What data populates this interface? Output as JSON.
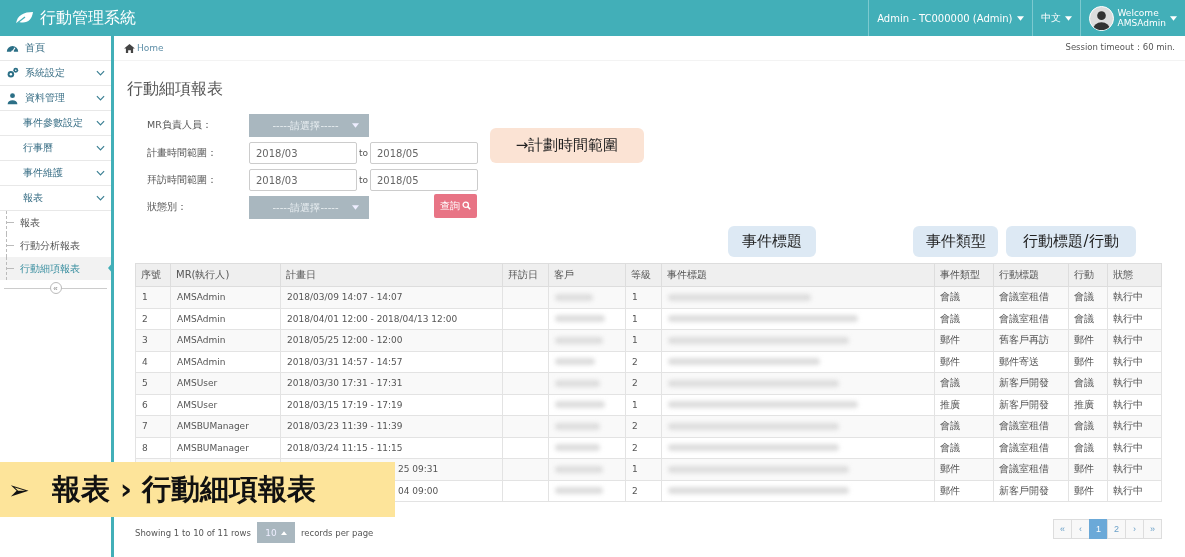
{
  "header": {
    "app_title": "行動管理系統",
    "account": "Admin - TC000000 (Admin)",
    "language": "中文",
    "welcome": "Welcome",
    "user": "AMSAdmin"
  },
  "sidebar": {
    "items": [
      {
        "label": "首頁",
        "kind": "link"
      },
      {
        "label": "系統設定",
        "kind": "menu"
      },
      {
        "label": "資料管理",
        "kind": "menu",
        "children": [
          {
            "label": "事件參數設定",
            "kind": "menu"
          },
          {
            "label": "行事曆",
            "kind": "menu"
          },
          {
            "label": "事件維護",
            "kind": "menu"
          },
          {
            "label": "報表",
            "kind": "menu",
            "children": [
              {
                "label": "報表",
                "selected": false
              },
              {
                "label": "行動分析報表",
                "selected": false
              },
              {
                "label": "行動細項報表",
                "selected": true
              }
            ]
          }
        ]
      }
    ],
    "collapse": "«"
  },
  "breadcrumb": "Home",
  "session": "Session timeout：60 min.",
  "page_title": "行動細項報表",
  "form": [
    {
      "kind": "select",
      "label": "MR負責人員：",
      "placeholder": "-----請選擇-----"
    },
    {
      "kind": "range",
      "label": "計畫時間範圍：",
      "from": "2018/03",
      "sep": "to",
      "to": "2018/05"
    },
    {
      "kind": "range",
      "label": "拜訪時間範圍：",
      "from": "2018/03",
      "sep": "to",
      "to": "2018/05"
    },
    {
      "kind": "select",
      "label": "狀態別：",
      "placeholder": "-----請選擇-----",
      "button": "查詢"
    }
  ],
  "annotations": [
    {
      "kind": "orange",
      "text": "→計劃時間範圍"
    },
    {
      "kind": "blue",
      "text": "事件標題"
    },
    {
      "kind": "blue",
      "text": "事件類型"
    },
    {
      "kind": "blue",
      "text": "行動標題/行動"
    }
  ],
  "table": {
    "columns": [
      "序號",
      "MR(執行人)",
      "計畫日",
      "拜訪日",
      "客戶",
      "等級",
      "事件標題",
      "事件類型",
      "行動標題",
      "行動",
      "狀態"
    ],
    "rows": [
      {
        "seq": "1",
        "mr": "AMSAdmin",
        "plan": "2018/03/09 14:07 - 14:07",
        "level": "1",
        "event_type": "會議",
        "action_title": "會議室租借",
        "action": "會議",
        "status": "執行中"
      },
      {
        "seq": "2",
        "mr": "AMSAdmin",
        "plan": "2018/04/01 12:00 - 2018/04/13 12:00",
        "level": "1",
        "event_type": "會議",
        "action_title": "會議室租借",
        "action": "會議",
        "status": "執行中"
      },
      {
        "seq": "3",
        "mr": "AMSAdmin",
        "plan": "2018/05/25 12:00 - 12:00",
        "level": "1",
        "event_type": "郵件",
        "action_title": "舊客戶再訪",
        "action": "郵件",
        "status": "執行中"
      },
      {
        "seq": "4",
        "mr": "AMSAdmin",
        "plan": "2018/03/31 14:57 - 14:57",
        "level": "2",
        "event_type": "郵件",
        "action_title": "郵件寄送",
        "action": "郵件",
        "status": "執行中"
      },
      {
        "seq": "5",
        "mr": "AMSUser",
        "plan": "2018/03/30 17:31 - 17:31",
        "level": "2",
        "event_type": "會議",
        "action_title": "新客戶開發",
        "action": "會議",
        "status": "執行中"
      },
      {
        "seq": "6",
        "mr": "AMSUser",
        "plan": "2018/03/15 17:19 - 17:19",
        "level": "1",
        "event_type": "推廣",
        "action_title": "新客戶開發",
        "action": "推廣",
        "status": "執行中"
      },
      {
        "seq": "7",
        "mr": "AMSBUManager",
        "plan": "2018/03/23 11:39 - 11:39",
        "level": "2",
        "event_type": "會議",
        "action_title": "會議室租借",
        "action": "會議",
        "status": "執行中"
      },
      {
        "seq": "8",
        "mr": "AMSBUManager",
        "plan": "2018/03/24 11:15 - 11:15",
        "level": "2",
        "event_type": "會議",
        "action_title": "會議室租借",
        "action": "會議",
        "status": "執行中"
      },
      {
        "plan": "25 09:31",
        "level": "1",
        "event_type": "郵件",
        "action_title": "會議室租借",
        "action": "郵件",
        "status": "執行中"
      },
      {
        "plan": "04 09:00",
        "level": "2",
        "event_type": "郵件",
        "action_title": "新客戶開發",
        "action": "郵件",
        "status": "執行中"
      }
    ]
  },
  "footer": {
    "showing": "Showing 1 to 10 of 11 rows",
    "page_size": "10",
    "per_page": "records per page"
  },
  "pagination": [
    {
      "label": "«",
      "selected": false
    },
    {
      "label": "‹",
      "selected": false
    },
    {
      "label": "1",
      "selected": true
    },
    {
      "label": "2",
      "selected": false
    },
    {
      "label": "›",
      "selected": false
    },
    {
      "label": "»",
      "selected": false
    }
  ],
  "banner": {
    "marker": "➢",
    "text": "報表 › 行動細項報表"
  }
}
